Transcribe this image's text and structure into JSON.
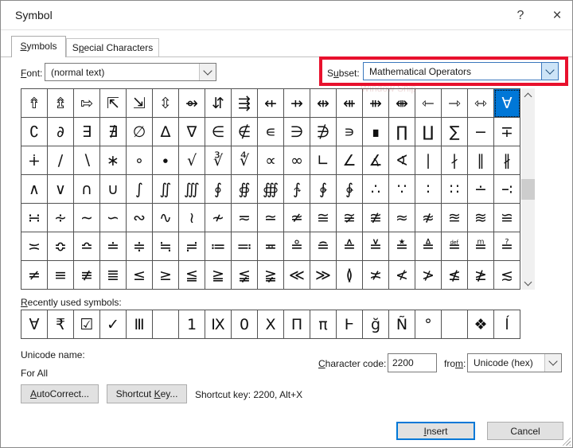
{
  "window": {
    "title": "Symbol",
    "help_icon": "?",
    "close_icon": "×"
  },
  "tabs": {
    "symbols": {
      "before": "",
      "accel": "S",
      "after": "ymbols"
    },
    "special": {
      "before": "S",
      "accel": "p",
      "after": "ecial Characters"
    }
  },
  "font": {
    "label": {
      "before": "",
      "accel": "F",
      "after": "ont:"
    },
    "value": "(normal text)"
  },
  "subset": {
    "label": {
      "before": "S",
      "accel": "u",
      "after": "bset:"
    },
    "value": "Mathematical Operators"
  },
  "annotation": {
    "watermark": "Window Snip",
    "highlight_color": "#e8112d"
  },
  "grid": {
    "columns": 19,
    "selected": {
      "row": 0,
      "col": 18,
      "char": "∀"
    },
    "rows": [
      [
        "⇮",
        "⇯",
        "⇰",
        "⇱",
        "⇲",
        "⇳",
        "⇴",
        "⇵",
        "⇶",
        "⇷",
        "⇸",
        "⇹",
        "⇺",
        "⇻",
        "⇼",
        "⇽",
        "⇾",
        "⇿",
        "∀"
      ],
      [
        "∁",
        "∂",
        "∃",
        "∄",
        "∅",
        "∆",
        "∇",
        "∈",
        "∉",
        "∊",
        "∋",
        "∌",
        "∍",
        "∎",
        "∏",
        "∐",
        "∑",
        "−",
        "∓"
      ],
      [
        "∔",
        "∕",
        "∖",
        "∗",
        "∘",
        "∙",
        "√",
        "∛",
        "∜",
        "∝",
        "∞",
        "∟",
        "∠",
        "∡",
        "∢",
        "∣",
        "∤",
        "∥",
        "∦"
      ],
      [
        "∧",
        "∨",
        "∩",
        "∪",
        "∫",
        "∬",
        "∭",
        "∮",
        "∯",
        "∰",
        "∱",
        "∲",
        "∳",
        "∴",
        "∵",
        "∶",
        "∷",
        "∸",
        "∹"
      ],
      [
        "∺",
        "∻",
        "∼",
        "∽",
        "∾",
        "∿",
        "≀",
        "≁",
        "≂",
        "≃",
        "≄",
        "≅",
        "≆",
        "≇",
        "≈",
        "≉",
        "≊",
        "≋",
        "≌"
      ],
      [
        "≍",
        "≎",
        "≏",
        "≐",
        "≑",
        "≒",
        "≓",
        "≔",
        "≕",
        "≖",
        "≗",
        "≘",
        "≙",
        "≚",
        "≛",
        "≜",
        "≝",
        "≞",
        "≟"
      ],
      [
        "≠",
        "≡",
        "≢",
        "≣",
        "≤",
        "≥",
        "≦",
        "≧",
        "≨",
        "≩",
        "≪",
        "≫",
        "≬",
        "≭",
        "≮",
        "≯",
        "≰",
        "≱",
        "≲"
      ]
    ]
  },
  "recent": {
    "label": {
      "before": "",
      "accel": "R",
      "after": "ecently used symbols:"
    },
    "symbols": [
      "∀",
      "₹",
      "☑",
      "✓",
      "Ⅲ",
      "",
      "1",
      "Ⅸ",
      "0",
      "Ⅹ",
      "Π",
      "π",
      "Ⱶ",
      "ğ",
      "Ñ",
      "°",
      "",
      "❖",
      "ĺ"
    ]
  },
  "details": {
    "unicode_name_label": "Unicode name:",
    "unicode_name_value": "For All",
    "char_code_label": {
      "before": "",
      "accel": "C",
      "after": "haracter code:"
    },
    "char_code_value": "2200",
    "from_label": {
      "before": "fro",
      "accel": "m",
      "after": ":"
    },
    "from_value": "Unicode (hex)"
  },
  "actions": {
    "autocorrect": {
      "before": "",
      "accel": "A",
      "after": "utoCorrect..."
    },
    "shortcut_key": {
      "before": "Shortcut ",
      "accel": "K",
      "after": "ey..."
    },
    "shortcut_text": "Shortcut key: 2200, Alt+X",
    "insert": {
      "before": "",
      "accel": "I",
      "after": "nsert"
    },
    "cancel_label": "Cancel"
  },
  "colors": {
    "selection_blue": "#0077d7",
    "highlight_red": "#e8112d",
    "button_gray": "#e1e1e1"
  }
}
